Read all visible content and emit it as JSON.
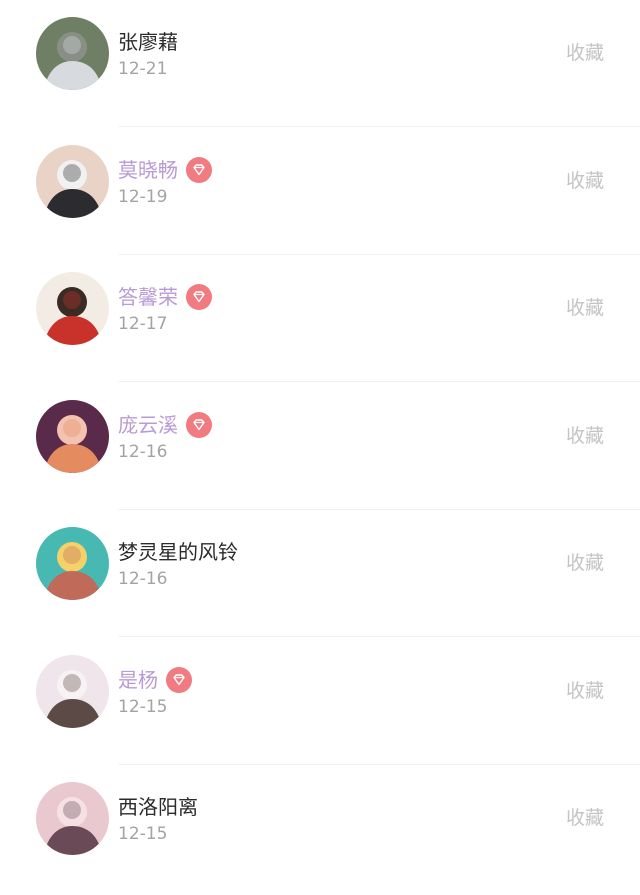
{
  "list": {
    "items": [
      {
        "name": "张廖藉",
        "date": "12-21",
        "vip": false,
        "action": "收藏",
        "avatar_colors": [
          "#6f7f65",
          "#d7dbe0",
          "#8a8f86"
        ]
      },
      {
        "name": "莫晓畅",
        "date": "12-19",
        "vip": true,
        "action": "收藏",
        "avatar_colors": [
          "#e9d3c6",
          "#2c2c30",
          "#f1f1f1"
        ]
      },
      {
        "name": "答馨荣",
        "date": "12-17",
        "vip": true,
        "action": "收藏",
        "avatar_colors": [
          "#f2ece4",
          "#c8322b",
          "#3a2b25"
        ]
      },
      {
        "name": "庞云溪",
        "date": "12-16",
        "vip": true,
        "action": "收藏",
        "avatar_colors": [
          "#5a2a4a",
          "#e58b60",
          "#f3c2b0"
        ]
      },
      {
        "name": "梦灵星的风铃",
        "date": "12-16",
        "vip": false,
        "action": "收藏",
        "avatar_colors": [
          "#47b8b2",
          "#c06a5a",
          "#f4d16a"
        ]
      },
      {
        "name": "是杨",
        "date": "12-15",
        "vip": true,
        "action": "收藏",
        "avatar_colors": [
          "#efe5ea",
          "#5b4a46",
          "#f7f3f4"
        ]
      },
      {
        "name": "西洛阳离",
        "date": "12-15",
        "vip": false,
        "action": "收藏",
        "avatar_colors": [
          "#e9c9cf",
          "#6b4a57",
          "#f5e1e4"
        ]
      }
    ]
  },
  "colors": {
    "vip_name": "#b99ad6",
    "normal_name": "#2b2b2b",
    "date": "#a3a3a3",
    "collect": "#c4c4c4",
    "vip_badge": "#f07b80"
  },
  "icons": {
    "vip_badge": "diamond-icon"
  }
}
